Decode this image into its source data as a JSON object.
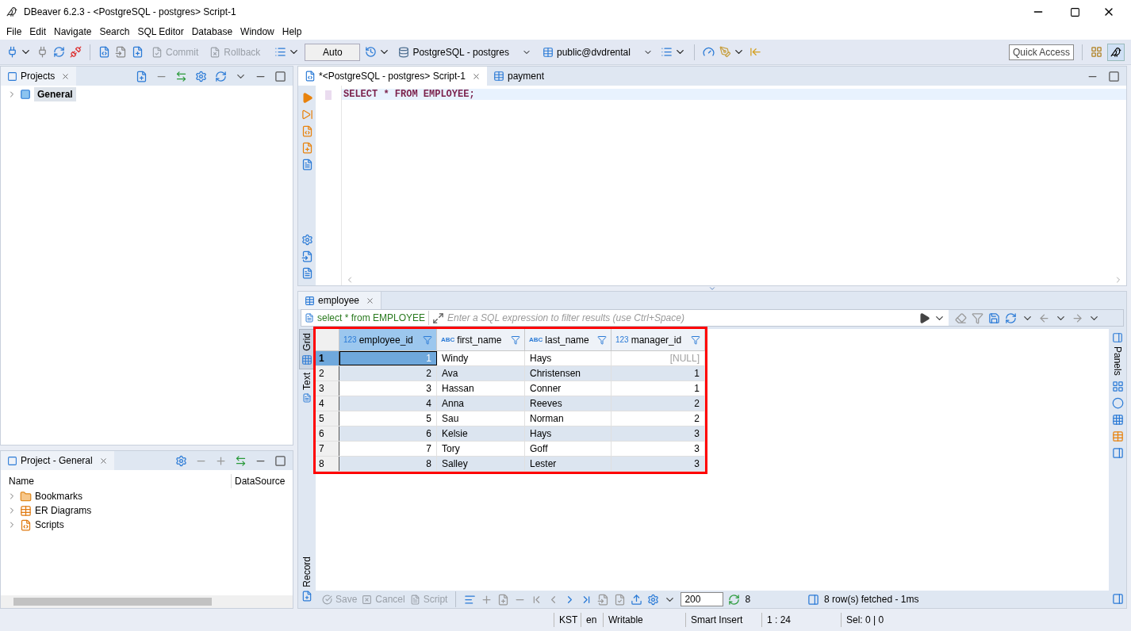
{
  "window": {
    "title": "DBeaver 6.2.3 - <PostgreSQL - postgres> Script-1"
  },
  "menu": [
    "File",
    "Edit",
    "Navigate",
    "Search",
    "SQL Editor",
    "Database",
    "Window",
    "Help"
  ],
  "toolbar": {
    "commit": "Commit",
    "rollback": "Rollback",
    "mode": "Auto",
    "connection": "PostgreSQL - postgres",
    "schema": "public@dvdrental",
    "quick_access": "Quick Access"
  },
  "projects_panel": {
    "title": "Projects",
    "tree": [
      {
        "label": "General",
        "selected": true
      }
    ]
  },
  "project_panel": {
    "title": "Project - General",
    "columns": [
      "Name",
      "DataSource"
    ],
    "items": [
      {
        "label": "Bookmarks",
        "kind": "bookmarks"
      },
      {
        "label": "ER Diagrams",
        "kind": "diagrams"
      },
      {
        "label": "Scripts",
        "kind": "scripts"
      }
    ]
  },
  "editor": {
    "tabs": [
      {
        "label": "*<PostgreSQL - postgres> Script-1",
        "selected": true,
        "kind": "script"
      },
      {
        "label": "payment",
        "selected": false,
        "kind": "table"
      }
    ],
    "sql": "SELECT * FROM EMPLOYEE;"
  },
  "results": {
    "tab": "employee",
    "query": "select * from EMPLOYEE",
    "filter_placeholder": "Enter a SQL expression to filter results (use Ctrl+Space)",
    "views": [
      {
        "label": "Grid",
        "selected": true
      },
      {
        "label": "Text",
        "selected": false
      }
    ],
    "record": "Record",
    "panels": "Panels",
    "highlighted": true,
    "columns": [
      {
        "type_label": "123",
        "name": "employee_id",
        "kind": "number",
        "selected": true
      },
      {
        "type_label": "ABC",
        "name": "first_name",
        "kind": "text",
        "selected": false
      },
      {
        "type_label": "ABC",
        "name": "last_name",
        "kind": "text",
        "selected": false
      },
      {
        "type_label": "123",
        "name": "manager_id",
        "kind": "number",
        "selected": false
      }
    ],
    "rows": [
      {
        "num": "1",
        "selected": true,
        "cells": [
          "1",
          "Windy",
          "Hays",
          "[NULL]"
        ],
        "nulls": [
          false,
          false,
          false,
          true
        ]
      },
      {
        "num": "2",
        "selected": false,
        "cells": [
          "2",
          "Ava",
          "Christensen",
          "1"
        ],
        "nulls": [
          false,
          false,
          false,
          false
        ]
      },
      {
        "num": "3",
        "selected": false,
        "cells": [
          "3",
          "Hassan",
          "Conner",
          "1"
        ],
        "nulls": [
          false,
          false,
          false,
          false
        ]
      },
      {
        "num": "4",
        "selected": false,
        "cells": [
          "4",
          "Anna",
          "Reeves",
          "2"
        ],
        "nulls": [
          false,
          false,
          false,
          false
        ]
      },
      {
        "num": "5",
        "selected": false,
        "cells": [
          "5",
          "Sau",
          "Norman",
          "2"
        ],
        "nulls": [
          false,
          false,
          false,
          false
        ]
      },
      {
        "num": "6",
        "selected": false,
        "cells": [
          "6",
          "Kelsie",
          "Hays",
          "3"
        ],
        "nulls": [
          false,
          false,
          false,
          false
        ]
      },
      {
        "num": "7",
        "selected": false,
        "cells": [
          "7",
          "Tory",
          "Goff",
          "3"
        ],
        "nulls": [
          false,
          false,
          false,
          false
        ]
      },
      {
        "num": "8",
        "selected": false,
        "cells": [
          "8",
          "Salley",
          "Lester",
          "3"
        ],
        "nulls": [
          false,
          false,
          false,
          false
        ]
      }
    ],
    "bottom": {
      "save": "Save",
      "cancel": "Cancel",
      "script": "Script",
      "fetch_size": "200",
      "count": "8",
      "status": "8 row(s) fetched - 1ms"
    }
  },
  "status_bar": [
    "KST",
    "en",
    "Writable",
    "Smart Insert",
    "1 : 24",
    "Sel: 0 | 0"
  ]
}
